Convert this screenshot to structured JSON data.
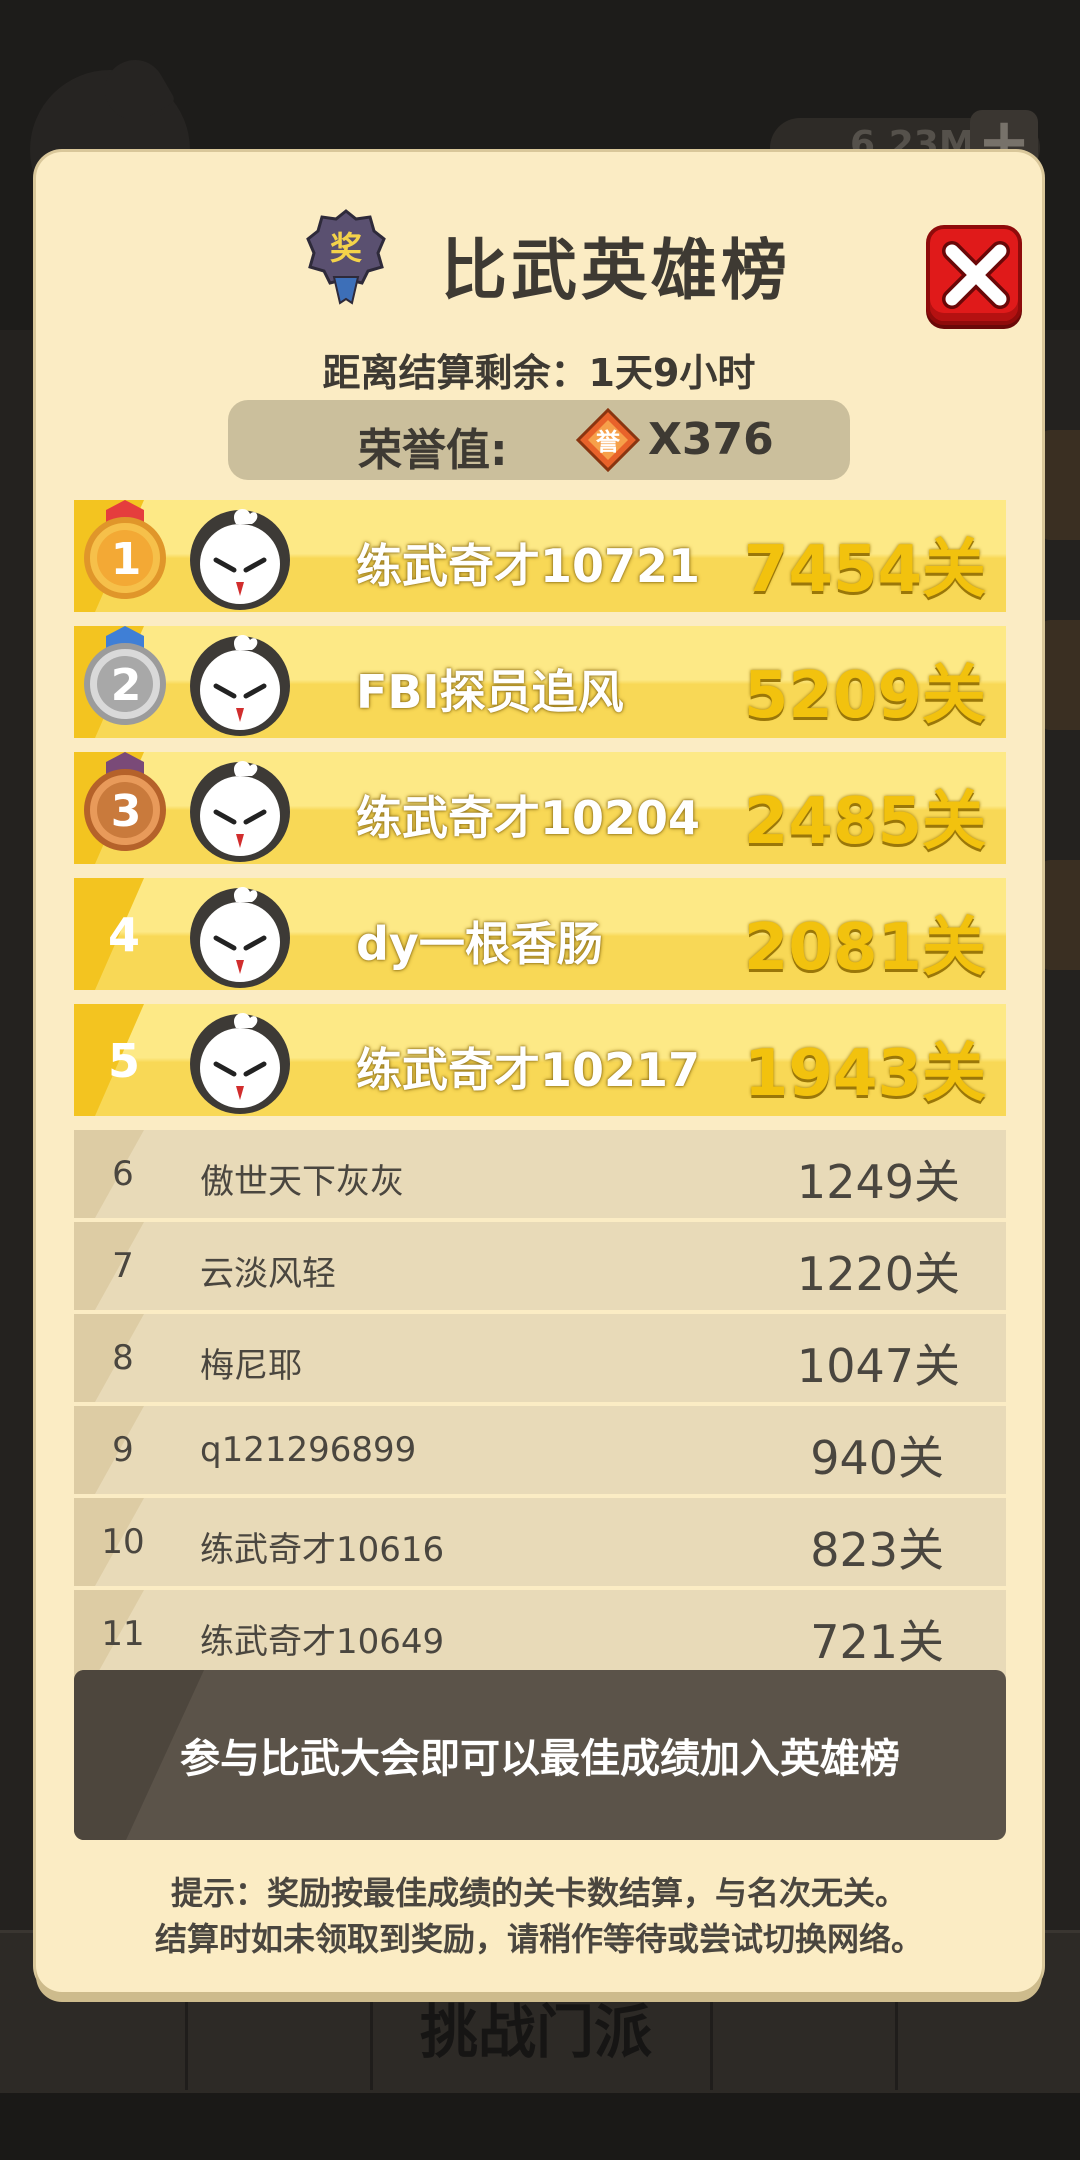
{
  "background": {
    "resource_value": "6.23M",
    "nav_label": "挑战门派"
  },
  "modal": {
    "title": "比武英雄榜",
    "award_icon_char": "奖",
    "countdown": "距离结算剩余：1天9小时",
    "honor": {
      "label": "荣誉值:",
      "icon_char": "誉",
      "value": "X376"
    },
    "top_ranks": [
      {
        "rank": "1",
        "name": "练武奇才10721",
        "score": "7454关",
        "medal": "gold"
      },
      {
        "rank": "2",
        "name": "FBI探员追风",
        "score": "5209关",
        "medal": "silver"
      },
      {
        "rank": "3",
        "name": "练武奇才10204",
        "score": "2485关",
        "medal": "bronze"
      },
      {
        "rank": "4",
        "name": "dy一根香肠",
        "score": "2081关"
      },
      {
        "rank": "5",
        "name": "练武奇才10217",
        "score": "1943关"
      }
    ],
    "other_ranks": [
      {
        "rank": "6",
        "name": "傲世天下灰灰",
        "score": "1249关"
      },
      {
        "rank": "7",
        "name": "云淡风轻",
        "score": "1220关"
      },
      {
        "rank": "8",
        "name": "梅尼耶",
        "score": "1047关"
      },
      {
        "rank": "9",
        "name": "q121296899",
        "score": "940关"
      },
      {
        "rank": "10",
        "name": "练武奇才10616",
        "score": "823关"
      },
      {
        "rank": "11",
        "name": "练武奇才10649",
        "score": "721关"
      }
    ],
    "join_text": "参与比武大会即可以最佳成绩加入英雄榜",
    "tip_line1": "提示：奖励按最佳成绩的关卡数结算，与名次无关。",
    "tip_line2": "结算时如未领取到奖励，请稍作等待或尝试切换网络。"
  },
  "colors": {
    "modal_bg": "#fbecc4",
    "top_row": "#f8d856",
    "score_gold": "#f2c20e",
    "close_red": "#e01a1a",
    "banner": "#5b5349"
  },
  "icons": {
    "close": "close-icon",
    "award": "award-badge-icon",
    "honor": "honor-token-icon",
    "avatar": "white-chick-avatar-icon"
  }
}
